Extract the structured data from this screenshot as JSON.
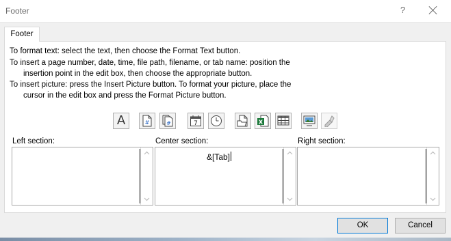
{
  "window": {
    "title": "Footer",
    "help_glyph": "?",
    "close_icon": "close-icon"
  },
  "tab": {
    "label": "Footer"
  },
  "instructions": [
    "To format text:  select the text, then choose the Format Text button.",
    "To insert a page number, date, time, file path, filename, or tab name:  position the",
    "insertion point in the edit box, then choose the appropriate button.",
    "To insert picture: press the Insert Picture button.  To format your picture, place the",
    "cursor in the edit box and press the Format Picture button."
  ],
  "toolbar": {
    "buttons": [
      {
        "icon": "format-text-icon",
        "glyph": "A"
      },
      {
        "icon": "insert-page-number-icon"
      },
      {
        "icon": "insert-number-of-pages-icon"
      },
      {
        "icon": "insert-date-icon",
        "glyph": "7"
      },
      {
        "icon": "insert-time-icon"
      },
      {
        "icon": "insert-file-path-icon"
      },
      {
        "icon": "insert-file-name-icon"
      },
      {
        "icon": "insert-sheet-name-icon"
      },
      {
        "icon": "insert-picture-icon"
      },
      {
        "icon": "format-picture-icon"
      }
    ]
  },
  "sections": {
    "left": {
      "label": "Left section:",
      "value": ""
    },
    "center": {
      "label": "Center section:",
      "value": "&[Tab]"
    },
    "right": {
      "label": "Right section:",
      "value": ""
    }
  },
  "buttons": {
    "ok": "OK",
    "cancel": "Cancel"
  }
}
